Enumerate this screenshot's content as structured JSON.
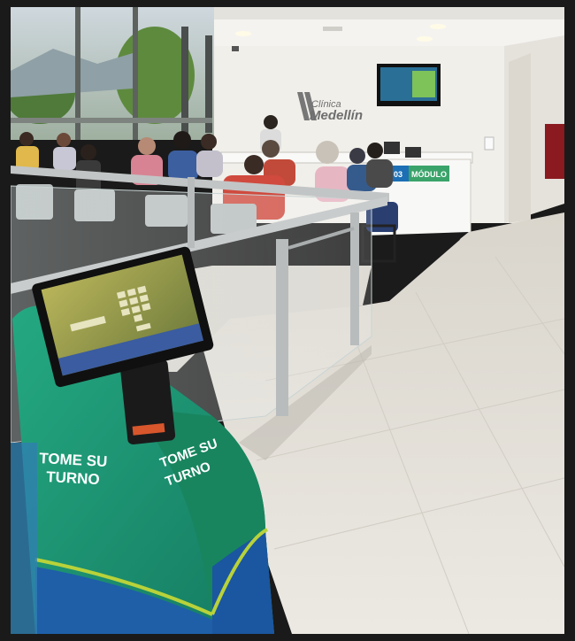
{
  "signage": {
    "clinic_logo_line1": "Clínica",
    "clinic_logo_line2": "Medellín",
    "module_number": "03",
    "module_label": "MÓDULO"
  },
  "kiosk": {
    "front_text_line1": "TOME SU",
    "front_text_line2": "TURNO",
    "side_text_line1": "TOME SU",
    "side_text_line2": "TURNO"
  },
  "colors": {
    "kiosk_green": "#1f9a78",
    "kiosk_blue": "#1e5fa8",
    "module_sign_green": "#3aa36a",
    "module_sign_blue": "#1c6fb5",
    "floor": "#e6e3dc",
    "wall": "#f1efea"
  }
}
